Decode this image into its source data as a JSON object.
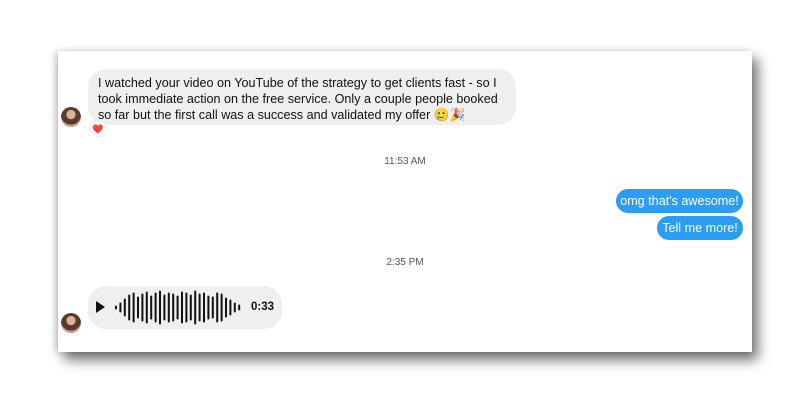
{
  "conversation": {
    "incoming_1": {
      "text": "I watched your video on YouTube of the strategy to get clients fast - so I took immediate action on the free service. Only a couple people booked so far but the first call was a success and validated my offer 🥲🎉",
      "reaction": "❤️"
    },
    "timestamp_1": "11:53 AM",
    "outgoing_1": "omg that's awesome!",
    "outgoing_2": "Tell me more!",
    "timestamp_2": "2:35 PM",
    "voice_message": {
      "duration": "0:33",
      "play_icon": "play-icon"
    }
  },
  "colors": {
    "incoming_bubble": "#efeff0",
    "outgoing_bubble": "#2a9df4",
    "reaction_heart": "#e0245e"
  }
}
